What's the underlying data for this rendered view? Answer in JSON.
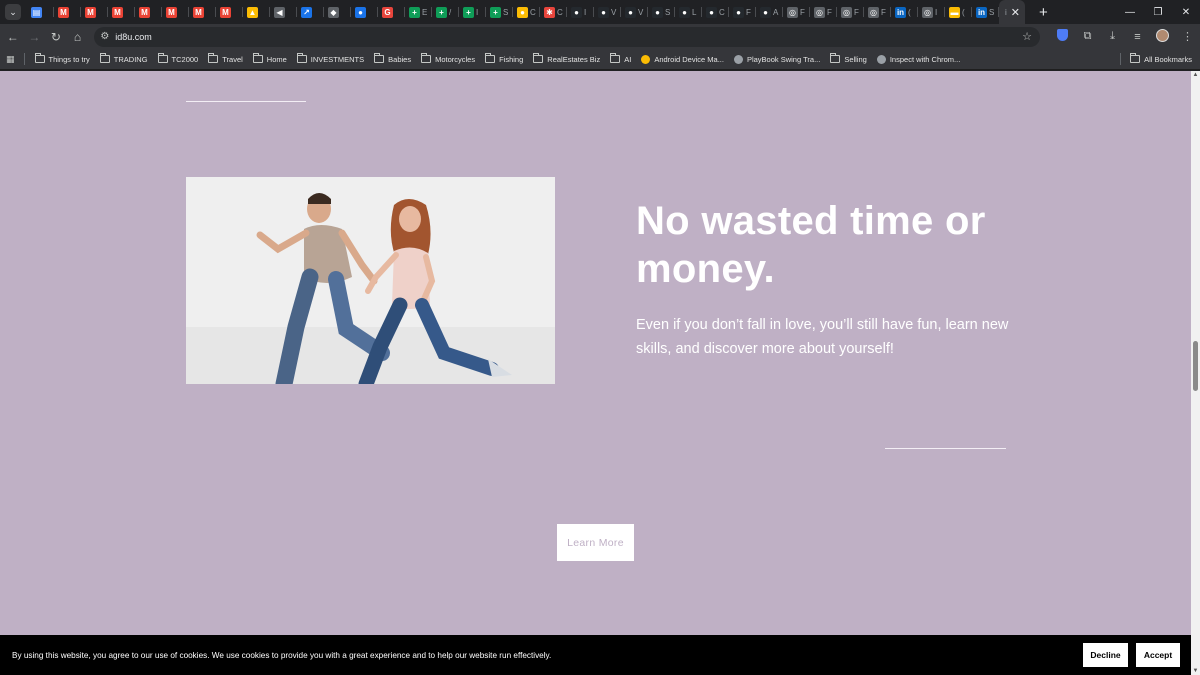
{
  "browser": {
    "tabs": [
      {
        "icon": "google-docs-icon",
        "color": "#4285f4",
        "glyph": "▤",
        "label": ""
      },
      {
        "icon": "gmail-icon",
        "color": "#ea4335",
        "glyph": "M",
        "label": ""
      },
      {
        "icon": "gmail-icon",
        "color": "#ea4335",
        "glyph": "M",
        "label": ""
      },
      {
        "icon": "gmail-icon",
        "color": "#ea4335",
        "glyph": "M",
        "label": ""
      },
      {
        "icon": "gmail-icon",
        "color": "#ea4335",
        "glyph": "M",
        "label": ""
      },
      {
        "icon": "gmail-icon",
        "color": "#ea4335",
        "glyph": "M",
        "label": ""
      },
      {
        "icon": "gmail-icon",
        "color": "#ea4335",
        "glyph": "M",
        "label": ""
      },
      {
        "icon": "gmail-icon",
        "color": "#ea4335",
        "glyph": "M",
        "label": ""
      },
      {
        "icon": "google-drive-icon",
        "color": "#fbbc04",
        "glyph": "▲",
        "label": ""
      },
      {
        "icon": "audio-icon",
        "color": "#5f6368",
        "glyph": "◀",
        "label": ""
      },
      {
        "icon": "app-icon",
        "color": "#1a73e8",
        "glyph": "↗",
        "label": ""
      },
      {
        "icon": "shield-app-icon",
        "color": "#5f6368",
        "glyph": "◆",
        "label": ""
      },
      {
        "icon": "app-icon",
        "color": "#1a73e8",
        "glyph": "●",
        "label": ""
      },
      {
        "icon": "app-icon",
        "color": "#e8453c",
        "glyph": "G",
        "label": ""
      },
      {
        "icon": "sheets-icon",
        "color": "#0f9d58",
        "glyph": "+",
        "label": "E"
      },
      {
        "icon": "sheets-icon",
        "color": "#0f9d58",
        "glyph": "+",
        "label": "/"
      },
      {
        "icon": "sheets-icon",
        "color": "#0f9d58",
        "glyph": "+",
        "label": "I"
      },
      {
        "icon": "sheets-icon",
        "color": "#0f9d58",
        "glyph": "+",
        "label": "S"
      },
      {
        "icon": "app-icon",
        "color": "#fbbc04",
        "glyph": "●",
        "label": "C"
      },
      {
        "icon": "app-icon",
        "color": "#e8453c",
        "glyph": "✱",
        "label": "C"
      },
      {
        "icon": "github-icon",
        "color": "#24292e",
        "glyph": "●",
        "label": "I"
      },
      {
        "icon": "github-icon",
        "color": "#24292e",
        "glyph": "●",
        "label": "V"
      },
      {
        "icon": "github-icon",
        "color": "#24292e",
        "glyph": "●",
        "label": "V"
      },
      {
        "icon": "github-icon",
        "color": "#24292e",
        "glyph": "●",
        "label": "S"
      },
      {
        "icon": "github-icon",
        "color": "#24292e",
        "glyph": "●",
        "label": "L"
      },
      {
        "icon": "github-icon",
        "color": "#24292e",
        "glyph": "●",
        "label": "C"
      },
      {
        "icon": "github-icon",
        "color": "#24292e",
        "glyph": "●",
        "label": "F"
      },
      {
        "icon": "github-icon",
        "color": "#24292e",
        "glyph": "●",
        "label": "A"
      },
      {
        "icon": "web-icon",
        "color": "#5f6368",
        "glyph": "◎",
        "label": "F"
      },
      {
        "icon": "web-icon",
        "color": "#5f6368",
        "glyph": "◎",
        "label": "F"
      },
      {
        "icon": "web-icon",
        "color": "#5f6368",
        "glyph": "◎",
        "label": "F"
      },
      {
        "icon": "web-icon",
        "color": "#5f6368",
        "glyph": "◎",
        "label": "F"
      },
      {
        "icon": "linkedin-icon",
        "color": "#0a66c2",
        "glyph": "in",
        "label": "("
      },
      {
        "icon": "web-icon",
        "color": "#5f6368",
        "glyph": "◎",
        "label": "I"
      },
      {
        "icon": "app-icon",
        "color": "#fbbc04",
        "glyph": "▬",
        "label": "("
      },
      {
        "icon": "linkedin-icon",
        "color": "#0a66c2",
        "glyph": "in",
        "label": "S"
      }
    ],
    "active_tab_label": "i",
    "address": "id8u.com",
    "bookmarks": [
      {
        "label": "Things to try",
        "type": "folder"
      },
      {
        "label": "TRADING",
        "type": "folder"
      },
      {
        "label": "TC2000",
        "type": "folder"
      },
      {
        "label": "Travel",
        "type": "folder"
      },
      {
        "label": "Home",
        "type": "folder"
      },
      {
        "label": "INVESTMENTS",
        "type": "folder"
      },
      {
        "label": "Babies",
        "type": "folder"
      },
      {
        "label": "Motorcycles",
        "type": "folder"
      },
      {
        "label": "Fishing",
        "type": "folder"
      },
      {
        "label": "RealEstates Biz",
        "type": "folder"
      },
      {
        "label": "AI",
        "type": "folder"
      },
      {
        "label": "Android Device Ma...",
        "type": "link",
        "color": "#fbbc04"
      },
      {
        "label": "PlayBook Swing Tra...",
        "type": "link",
        "color": "#9aa0a6"
      },
      {
        "label": "Selling",
        "type": "folder"
      },
      {
        "label": "Inspect with Chrom...",
        "type": "link",
        "color": "#9aa0a6"
      }
    ],
    "all_bookmarks": "All Bookmarks"
  },
  "page": {
    "background": "#bfb0c5",
    "heading": "No wasted time or money.",
    "subtext": "Even if you don’t fall in love, you’ll still have fun, learn new skills, and discover more about yourself!",
    "cta_label": "Learn More"
  },
  "cookie_banner": {
    "text": "By using this website, you agree to our use of cookies. We use cookies to provide you with a great experience and to help our website run effectively.",
    "decline_label": "Decline",
    "accept_label": "Accept"
  }
}
